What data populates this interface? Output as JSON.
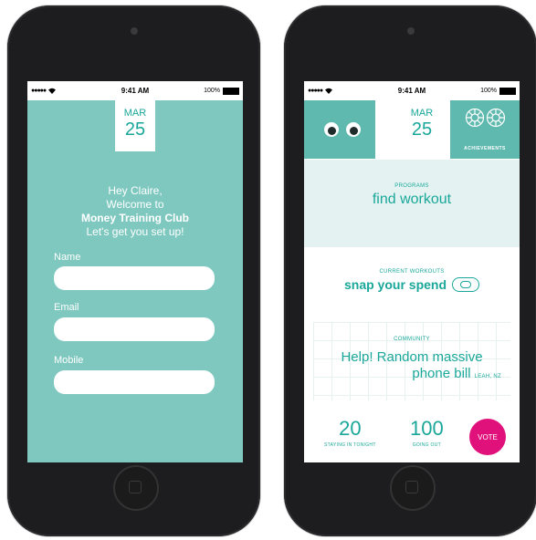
{
  "status_bar": {
    "signal": "●●●●● ",
    "wifi": "wifi-icon",
    "time": "9:41 AM",
    "battery_text": "100%"
  },
  "left_screen": {
    "date": {
      "month": "MAR",
      "day": "25"
    },
    "welcome": {
      "line1": "Hey Claire,",
      "line2": "Welcome to",
      "club": "Money Training Club",
      "line4": "Let's get you set up!"
    },
    "fields": [
      {
        "label": "Name",
        "value": ""
      },
      {
        "label": "Email",
        "value": ""
      },
      {
        "label": "Mobile",
        "value": ""
      }
    ]
  },
  "right_screen": {
    "date": {
      "month": "MAR",
      "day": "25"
    },
    "achievements_label": "ACHIEVEMENTS",
    "programs": {
      "label": "PROGRAMS",
      "title": "find workout"
    },
    "current_workouts": {
      "label": "CURRENT WORKOUTS",
      "title": "snap your spend"
    },
    "community": {
      "label": "COMMUNITY",
      "line1": "Help! Random massive",
      "line2": "phone bill",
      "author": "LEAH, NZ"
    },
    "stats": [
      {
        "value": "20",
        "label": "STAYING IN TONIGHT"
      },
      {
        "value": "100",
        "label": "GOING OUT"
      }
    ],
    "vote_label": "VOTE"
  },
  "colors": {
    "teal": "#7ec8bf",
    "teal_dark": "#1aa79a",
    "light_teal": "#e4f3f1",
    "vote_pink": "#e0117a"
  }
}
